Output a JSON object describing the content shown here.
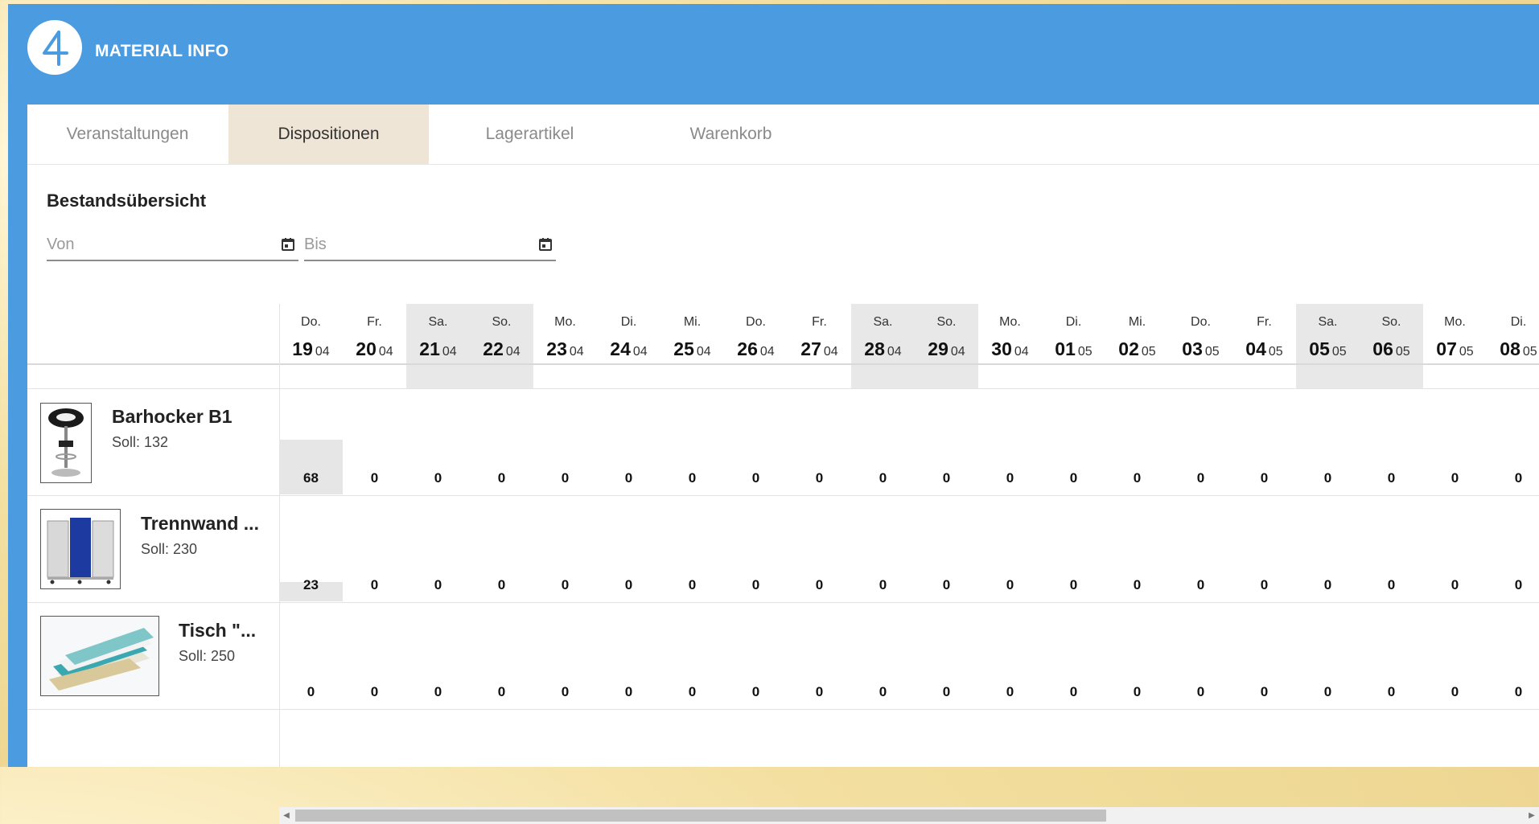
{
  "app": {
    "title": "MATERIAL INFO"
  },
  "tabs": [
    {
      "label": "Veranstaltungen",
      "active": false
    },
    {
      "label": "Dispositionen",
      "active": true
    },
    {
      "label": "Lagerartikel",
      "active": false
    },
    {
      "label": "Warenkorb",
      "active": false
    }
  ],
  "section": {
    "title": "Bestandsübersicht",
    "from_placeholder": "Von",
    "to_placeholder": "Bis"
  },
  "days": [
    {
      "wd": "Do.",
      "d": "19",
      "m": "04",
      "weekend": false
    },
    {
      "wd": "Fr.",
      "d": "20",
      "m": "04",
      "weekend": false
    },
    {
      "wd": "Sa.",
      "d": "21",
      "m": "04",
      "weekend": true
    },
    {
      "wd": "So.",
      "d": "22",
      "m": "04",
      "weekend": true
    },
    {
      "wd": "Mo.",
      "d": "23",
      "m": "04",
      "weekend": false
    },
    {
      "wd": "Di.",
      "d": "24",
      "m": "04",
      "weekend": false
    },
    {
      "wd": "Mi.",
      "d": "25",
      "m": "04",
      "weekend": false
    },
    {
      "wd": "Do.",
      "d": "26",
      "m": "04",
      "weekend": false
    },
    {
      "wd": "Fr.",
      "d": "27",
      "m": "04",
      "weekend": false
    },
    {
      "wd": "Sa.",
      "d": "28",
      "m": "04",
      "weekend": true
    },
    {
      "wd": "So.",
      "d": "29",
      "m": "04",
      "weekend": true
    },
    {
      "wd": "Mo.",
      "d": "30",
      "m": "04",
      "weekend": false
    },
    {
      "wd": "Di.",
      "d": "01",
      "m": "05",
      "weekend": false
    },
    {
      "wd": "Mi.",
      "d": "02",
      "m": "05",
      "weekend": false
    },
    {
      "wd": "Do.",
      "d": "03",
      "m": "05",
      "weekend": false
    },
    {
      "wd": "Fr.",
      "d": "04",
      "m": "05",
      "weekend": false
    },
    {
      "wd": "Sa.",
      "d": "05",
      "m": "05",
      "weekend": true
    },
    {
      "wd": "So.",
      "d": "06",
      "m": "05",
      "weekend": true
    },
    {
      "wd": "Mo.",
      "d": "07",
      "m": "05",
      "weekend": false
    },
    {
      "wd": "Di.",
      "d": "08",
      "m": "05",
      "weekend": false
    }
  ],
  "products": [
    {
      "name": "Barhocker B1",
      "soll": "Soll: 132",
      "thumb": "barstool-image",
      "first_fill": 0.52,
      "values": [
        "68",
        "0",
        "0",
        "0",
        "0",
        "0",
        "0",
        "0",
        "0",
        "0",
        "0",
        "0",
        "0",
        "0",
        "0",
        "0",
        "0",
        "0",
        "0",
        "0"
      ]
    },
    {
      "name": "Trennwand ...",
      "soll": "Soll: 230",
      "thumb": "partition-wall-image",
      "first_fill": 0.18,
      "values": [
        "23",
        "0",
        "0",
        "0",
        "0",
        "0",
        "0",
        "0",
        "0",
        "0",
        "0",
        "0",
        "0",
        "0",
        "0",
        "0",
        "0",
        "0",
        "0",
        "0"
      ]
    },
    {
      "name": "Tisch \"...",
      "soll": "Soll: 250",
      "thumb": "papers-image",
      "first_fill": 0,
      "values": [
        "0",
        "0",
        "0",
        "0",
        "0",
        "0",
        "0",
        "0",
        "0",
        "0",
        "0",
        "0",
        "0",
        "0",
        "0",
        "0",
        "0",
        "0",
        "0",
        "0"
      ]
    }
  ],
  "scrollbar": {
    "position": 0
  }
}
